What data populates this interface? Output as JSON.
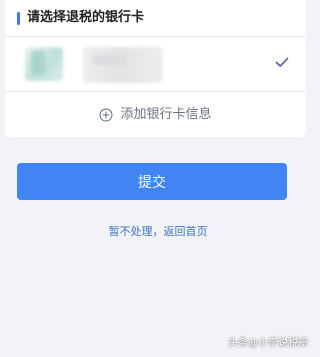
{
  "section": {
    "title": "请选择退税的银行卡"
  },
  "bank_card": {
    "selected": true
  },
  "add_card": {
    "label": "添加银行卡信息"
  },
  "submit": {
    "label": "提交"
  },
  "skip": {
    "label": "暂不处理，返回首页"
  },
  "watermark": {
    "text": "头条@小李说税新"
  },
  "colors": {
    "accent": "#3b7be8",
    "button": "#4085f3",
    "link": "#3f72c8",
    "background": "#f2f3f6"
  },
  "icons": {
    "check": "check-icon",
    "add": "plus-circle-icon"
  }
}
